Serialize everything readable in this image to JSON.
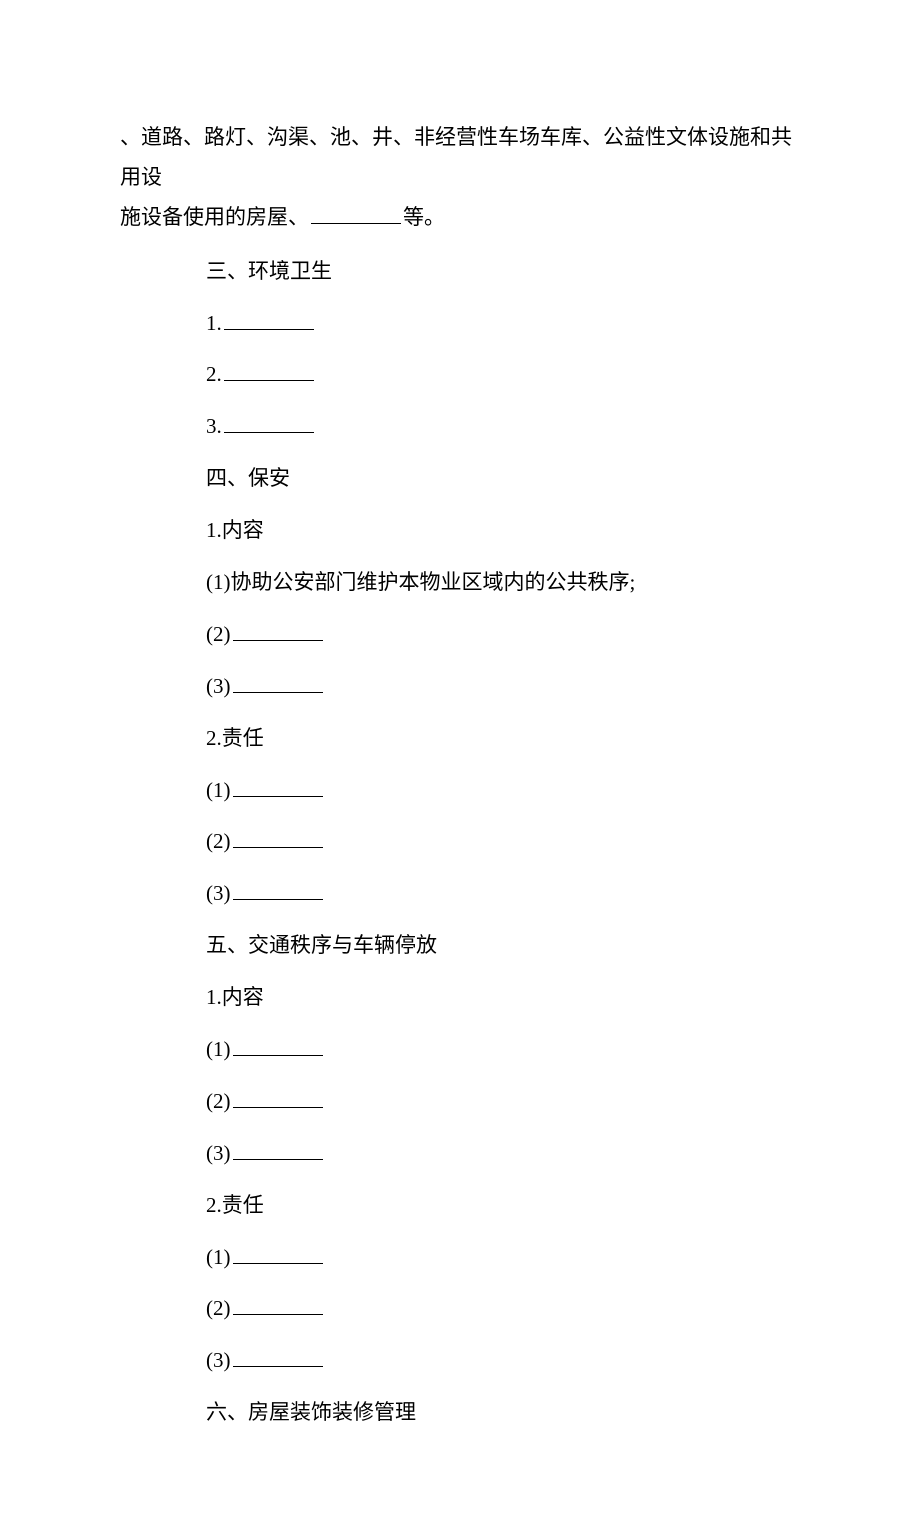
{
  "topParagraph": {
    "line1": "、道路、路灯、沟渠、池、井、非经营性车场车库、公益性文体设施和共用设",
    "line2Prefix": "施设备使用的房屋、",
    "line2Suffix": "等。"
  },
  "sectionEnv": {
    "title": "三、环境卫生",
    "items": [
      {
        "prefix": "1."
      },
      {
        "prefix": "2."
      },
      {
        "prefix": "3."
      }
    ]
  },
  "sectionSecurity": {
    "title": "四、保安",
    "contentLabel": "1.内容",
    "contentItems": [
      {
        "prefix": "(1)",
        "text": "协助公安部门维护本物业区域内的公共秩序;",
        "blank": false
      },
      {
        "prefix": "(2)",
        "blank": true
      },
      {
        "prefix": "(3)",
        "blank": true
      }
    ],
    "respLabel": "2.责任",
    "respItems": [
      {
        "prefix": "(1)",
        "blank": true
      },
      {
        "prefix": "(2)",
        "blank": true
      },
      {
        "prefix": "(3)",
        "blank": true
      }
    ]
  },
  "sectionTraffic": {
    "title": "五、交通秩序与车辆停放",
    "contentLabel": "1.内容",
    "contentItems": [
      {
        "prefix": "(1)",
        "blank": true
      },
      {
        "prefix": "(2)",
        "blank": true
      },
      {
        "prefix": "(3)",
        "blank": true
      }
    ],
    "respLabel": "2.责任",
    "respItems": [
      {
        "prefix": "(1)",
        "blank": true
      },
      {
        "prefix": "(2)",
        "blank": true
      },
      {
        "prefix": "(3)",
        "blank": true
      }
    ]
  },
  "sectionDecoration": {
    "title": "六、房屋装饰装修管理"
  }
}
